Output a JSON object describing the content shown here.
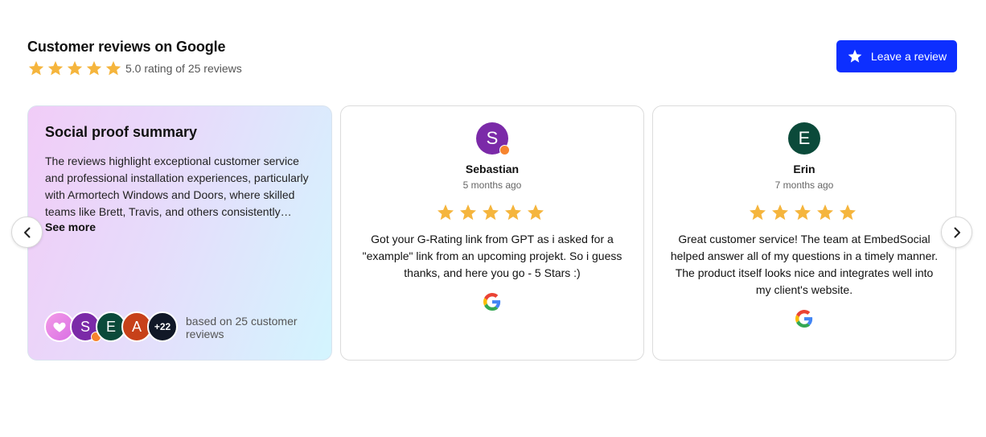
{
  "header": {
    "title": "Customer reviews on Google",
    "rating_stars": 5,
    "rating_text": "5.0 rating of 25 reviews",
    "leave_review_label": "Leave a review"
  },
  "colors": {
    "star": "#f5b53d",
    "button": "#0d2fff",
    "sebastian_avatar": "#7b2aa8",
    "erin_avatar": "#0b4a3a",
    "a_avatar": "#c7411a",
    "more_avatar": "#111827"
  },
  "summary": {
    "title": "Social proof summary",
    "text": "The reviews highlight exceptional customer service and professional installation experiences, particularly with Armortech Windows and Doors, where skilled teams like Brett, Travis, and others consistently…",
    "see_more": "See more",
    "avatars": [
      {
        "type": "heart-icon"
      },
      {
        "letter": "S"
      },
      {
        "letter": "E"
      },
      {
        "letter": "A"
      },
      {
        "letter": "+22"
      }
    ],
    "based_on": "based on 25 customer reviews"
  },
  "reviews": [
    {
      "initial": "S",
      "name": "Sebastian",
      "time": "5 months ago",
      "stars": 5,
      "text": "Got your G-Rating link from GPT as i asked for a \"example\" link from an upcoming projekt. So i guess thanks, and here you go - 5 Stars :)",
      "source_icon": "google-icon"
    },
    {
      "initial": "E",
      "name": "Erin",
      "time": "7 months ago",
      "stars": 5,
      "text": "Great customer service! The team at EmbedSocial helped answer all of my questions in a timely manner. The product itself looks nice and integrates well into my client's website.",
      "source_icon": "google-icon"
    }
  ],
  "nav": {
    "prev_icon": "chevron-left-icon",
    "next_icon": "chevron-right-icon"
  }
}
